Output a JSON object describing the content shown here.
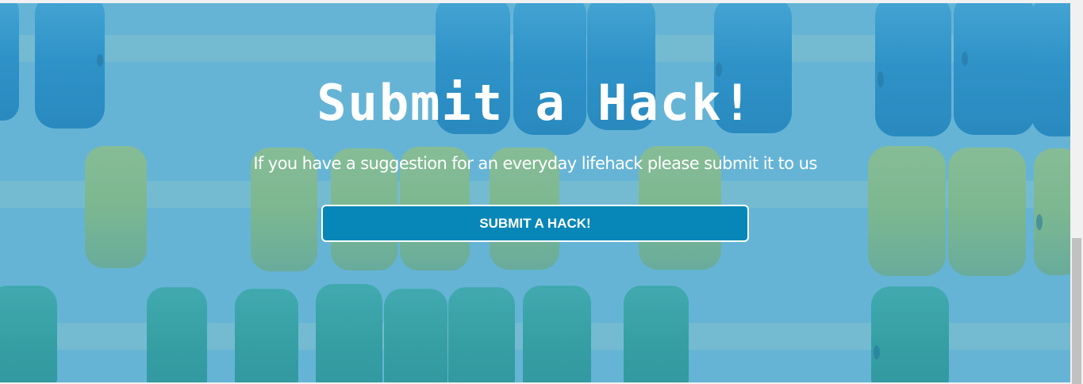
{
  "hero": {
    "title": "Submit a Hack!",
    "subtitle": "If you have a suggestion for an everyday lifehack please submit it to us",
    "button_label": "SUBMIT A HACK!"
  },
  "colors": {
    "overlay": "#66b5d6",
    "button": "#0786b8",
    "text": "#ffffff",
    "bead_blue": "#2a8fc4",
    "bead_green": "#8fbf77",
    "bead_teal": "#2a9e9a"
  },
  "background_image": {
    "icon": "abacus-beads-image"
  }
}
